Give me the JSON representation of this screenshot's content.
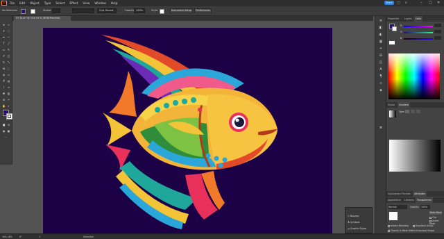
{
  "menu": [
    "File",
    "Edit",
    "Object",
    "Type",
    "Select",
    "Effect",
    "View",
    "Window",
    "Help"
  ],
  "share_label": "Share",
  "control": {
    "selection": "No Selection",
    "stroke_label": "Stroke:",
    "brush": "5 pt. Round",
    "opacity_label": "Opacity:",
    "opacity_value": "100%",
    "style_label": "Style:",
    "doc_setup": "Document Setup",
    "preferences": "Preferences"
  },
  "document_tab": "07 AI.ai* @ 104.16 % (RGB/Preview)",
  "panels": {
    "top_tabs": [
      "Properties",
      "Layers",
      "Color"
    ],
    "color_channels": [
      "R",
      "G",
      "B"
    ],
    "stroke_tabs": [
      "Stroke",
      "Gradient"
    ],
    "gradient_type_label": "Type:",
    "lower_tabs": [
      "Appearance",
      "Libraries",
      "Transparency"
    ],
    "mid_tabs": [
      "Separations Preview",
      "Attributes"
    ],
    "blend_mode": "Normal",
    "opacity_label": "Opacity:",
    "opacity_value": "100%",
    "make_mask": "Make Mask",
    "clip": "Clip",
    "invert_mask": "Invert Mask",
    "isolate_blending": "Isolate Blending",
    "knockout_group": "Knockout Group",
    "opacity_mask_label": "Opacity & Mask Define Knockout Shape"
  },
  "floating_panel": [
    "Brushes",
    "Symbols",
    "Graphic Styles"
  ],
  "status": {
    "zoom": "104.16%",
    "rotation": "0°",
    "artboard": "1",
    "tool": "Selection"
  },
  "colors": {
    "artboard": "#1d0147",
    "fill": "#2a0e6b",
    "accent": "#2680eb"
  }
}
